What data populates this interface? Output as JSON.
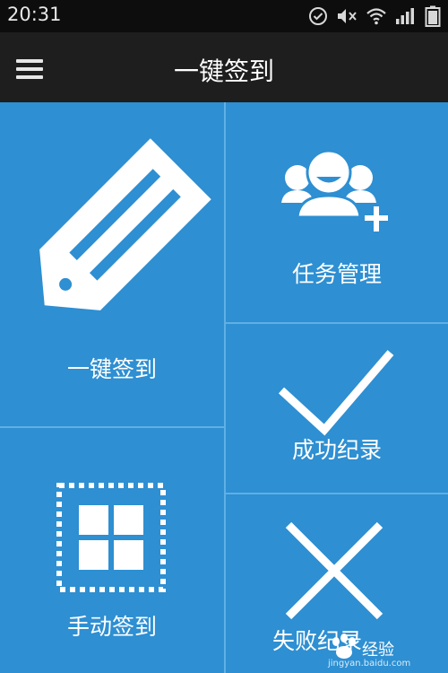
{
  "status_bar": {
    "time": "20:31",
    "icons": [
      "check-circle-icon",
      "mute-icon",
      "wifi-icon",
      "signal-icon",
      "battery-icon"
    ]
  },
  "title_bar": {
    "title": "一键签到",
    "menu_icon": "menu-icon"
  },
  "tiles": {
    "one_key_checkin": {
      "label": "一键签到",
      "icon": "tag-icon"
    },
    "task_management": {
      "label": "任务管理",
      "icon": "users-add-icon"
    },
    "success_records": {
      "label": "成功纪录",
      "icon": "checkmark-icon"
    },
    "manual_checkin": {
      "label": "手动签到",
      "icon": "grid-icon"
    },
    "failure_records": {
      "label": "失败纪录",
      "icon": "cross-icon"
    }
  },
  "watermark": {
    "brand": "经验",
    "url": "jingyan.baidu.com"
  },
  "colors": {
    "tile_bg": "#2e8fd2",
    "divider": "#5fb0e4",
    "titlebar": "#1e1e1e",
    "statusbar": "#0d0d0d"
  }
}
